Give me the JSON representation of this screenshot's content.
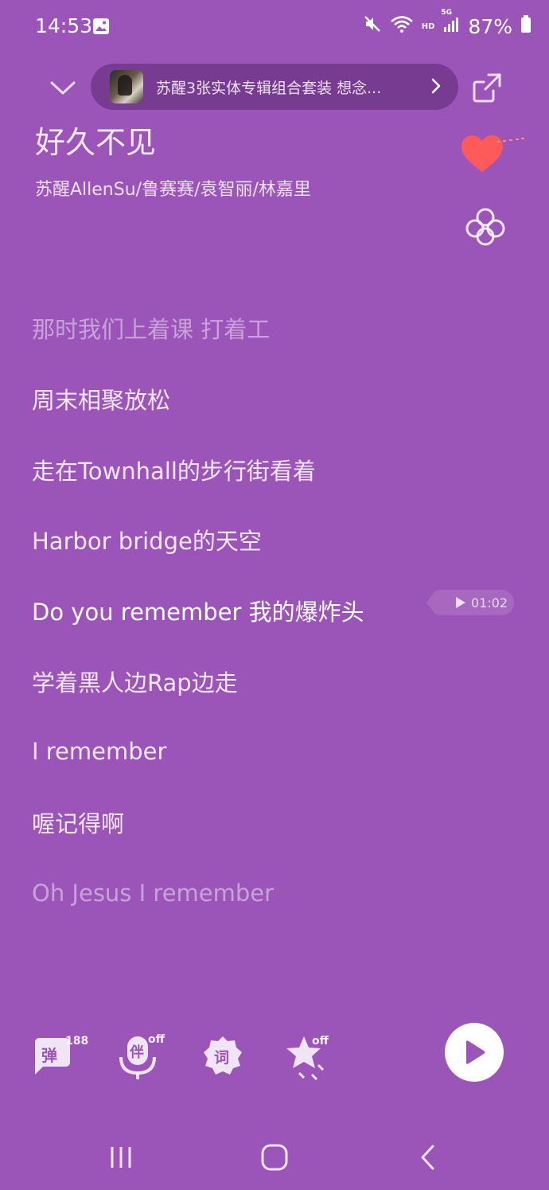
{
  "status_bar": {
    "time": "14:53",
    "network_label": "HD",
    "network_gen": "5G",
    "battery": "87%"
  },
  "banner": {
    "text": "苏醒3张实体专辑组合套装 想念..."
  },
  "song": {
    "title": "好久不见",
    "artists": "苏醒AllenSu/鲁赛赛/袁智丽/林嘉里"
  },
  "lyrics": [
    {
      "text": "那时我们上着课 打着工",
      "state": "dim"
    },
    {
      "text": "周末相聚放松",
      "state": "normal"
    },
    {
      "text": "走在Townhall的步行街看着",
      "state": "normal"
    },
    {
      "text": "Harbor bridge的天空",
      "state": "normal"
    },
    {
      "text": "Do you remember 我的爆炸头",
      "state": "active"
    },
    {
      "text": "学着黑人边Rap边走",
      "state": "normal"
    },
    {
      "text": "I remember",
      "state": "normal"
    },
    {
      "text": "喔记得啊",
      "state": "normal"
    },
    {
      "text": "Oh Jesus I remember",
      "state": "dim"
    }
  ],
  "seek": {
    "time": "01:02"
  },
  "tools": {
    "danmaku_glyph": "弹",
    "danmaku_count": "188",
    "accompany_glyph": "伴",
    "accompany_state": "off",
    "lyrics_glyph": "词",
    "effect_state": "off"
  },
  "colors": {
    "background": "#9b55b8",
    "like": "#ff5a5a"
  }
}
